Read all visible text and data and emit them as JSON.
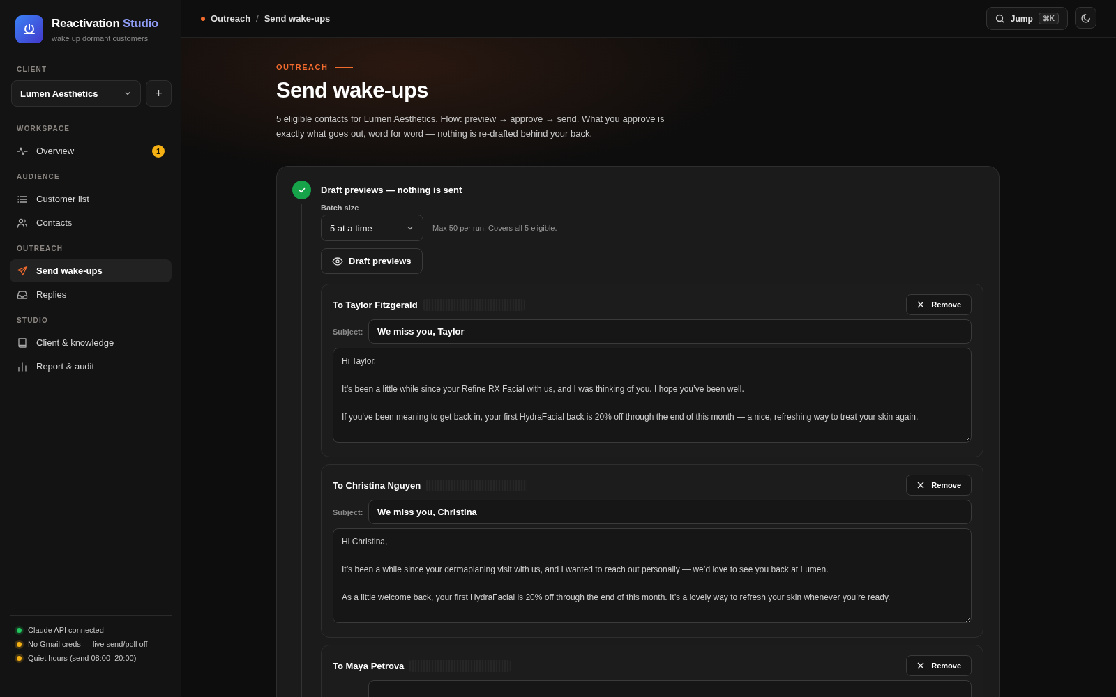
{
  "brand": {
    "name": "Reactivation",
    "accent": "Studio",
    "tagline": "wake up dormant customers"
  },
  "sidebar": {
    "client_label": "CLIENT",
    "client": "Lumen Aesthetics",
    "add": "+",
    "sections": [
      {
        "title": "WORKSPACE",
        "items": [
          {
            "label": "Overview",
            "kind": "pulse",
            "selected": false,
            "badge": "1"
          }
        ]
      },
      {
        "title": "AUDIENCE",
        "items": [
          {
            "label": "Customer list",
            "kind": "list",
            "selected": false
          },
          {
            "label": "Contacts",
            "kind": "people",
            "selected": false
          }
        ]
      },
      {
        "title": "OUTREACH",
        "items": [
          {
            "label": "Send wake-ups",
            "kind": "send",
            "selected": true
          },
          {
            "label": "Replies",
            "kind": "inbox",
            "selected": false
          }
        ]
      },
      {
        "title": "STUDIO",
        "items": [
          {
            "label": "Client & knowledge",
            "kind": "book",
            "selected": false
          },
          {
            "label": "Report & audit",
            "kind": "chart",
            "selected": false
          }
        ]
      }
    ],
    "status": [
      {
        "text": "Claude API connected",
        "color": "#22c55e"
      },
      {
        "text": "No Gmail creds — live send/poll off",
        "color": "#f5b014"
      },
      {
        "text": "Quiet hours (send 08:00–20:00)",
        "color": "#f5b014"
      }
    ]
  },
  "breadcrumb": {
    "items": [
      "Outreach",
      "Send wake-ups"
    ],
    "separator": "/"
  },
  "topbar": {
    "jump": "Jump",
    "shortcut": "⌘K"
  },
  "page": {
    "eyebrow": "OUTREACH",
    "title": "Send wake-ups",
    "description": "5 eligible contacts for Lumen Aesthetics. Flow: preview → approve → send. What you approve is exactly what goes out, word for word — nothing is re-drafted behind your back."
  },
  "step": {
    "title": "Draft previews — nothing is sent",
    "done": true,
    "batch_label": "Batch size",
    "batch": "5 at a time",
    "batch_hint": "Max 50 per run. Covers all 5 eligible.",
    "action": "Draft previews"
  },
  "drafts": [
    {
      "to": "To Taylor Fitzgerald",
      "remove": "Remove",
      "subject_label": "Subject:",
      "subject": "We miss you, Taylor",
      "body": "Hi Taylor,\n\nIt’s been a little while since your Refine RX Facial with us, and I was thinking of you. I hope you’ve been well.\n\nIf you’ve been meaning to get back in, your first HydraFacial back is 20% off through the end of this month — a nice, refreshing way to treat your skin again."
    },
    {
      "to": "To Christina Nguyen",
      "remove": "Remove",
      "subject_label": "Subject:",
      "subject": "We miss you, Christina",
      "body": "Hi Christina,\n\nIt’s been a while since your dermaplaning visit with us, and I wanted to reach out personally — we’d love to see you back at Lumen.\n\nAs a little welcome back, your first HydraFacial is 20% off through the end of this month. It’s a lovely way to refresh your skin whenever you’re ready."
    },
    {
      "to": "To Maya Petrova",
      "remove": "Remove"
    }
  ]
}
